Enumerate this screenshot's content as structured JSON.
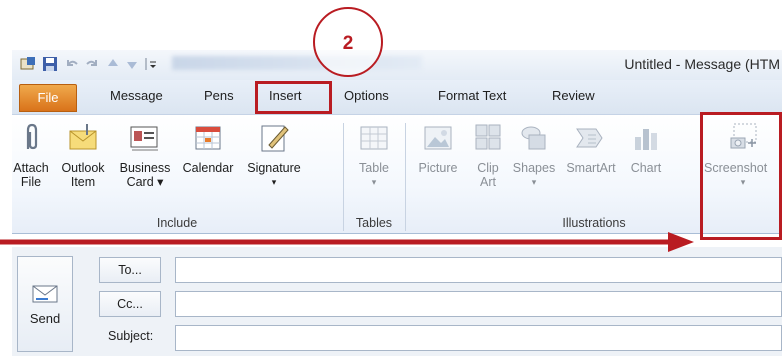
{
  "window": {
    "title": "Untitled - Message (HTM"
  },
  "tabs": [
    {
      "label": "File"
    },
    {
      "label": "Message"
    },
    {
      "label": "Pens"
    },
    {
      "label": "Insert"
    },
    {
      "label": "Options"
    },
    {
      "label": "Format Text"
    },
    {
      "label": "Review"
    }
  ],
  "ribbon": {
    "include": {
      "group_label": "Include",
      "attach_file": [
        "Attach",
        "File"
      ],
      "outlook_item": [
        "Outlook",
        "Item"
      ],
      "business_card": [
        "Business",
        "Card ▾"
      ],
      "calendar": "Calendar",
      "signature": [
        "Signature",
        "▾"
      ]
    },
    "tables": {
      "group_label": "Tables",
      "table": [
        "Table",
        "▾"
      ]
    },
    "illustrations": {
      "group_label": "Illustrations",
      "picture": "Picture",
      "clip_art": [
        "Clip",
        "Art"
      ],
      "shapes": [
        "Shapes",
        "▾"
      ],
      "smartart": "SmartArt",
      "chart": "Chart",
      "screenshot": [
        "Screenshot",
        "▾"
      ]
    }
  },
  "compose": {
    "send_label": "Send",
    "to_label": "To...",
    "cc_label": "Cc...",
    "subject_label": "Subject:"
  },
  "annotation": {
    "step_number": "2"
  },
  "colors": {
    "annotation_red": "#b91c22",
    "file_tab": "#d9731a"
  }
}
